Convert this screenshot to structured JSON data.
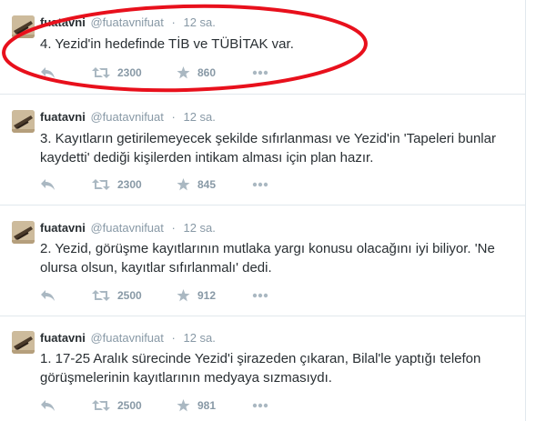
{
  "tweets": [
    {
      "name": "fuatavni",
      "handle": "@fuatavnifuat",
      "separator": "·",
      "time": "12 sa.",
      "text": "4. Yezid'in hedefinde TİB ve TÜBİTAK var.",
      "retweets": "2300",
      "favorites": "860"
    },
    {
      "name": "fuatavni",
      "handle": "@fuatavnifuat",
      "separator": "·",
      "time": "12 sa.",
      "text": "3. Kayıtların getirilemeyecek şekilde sıfırlanması ve Yezid'in 'Tapeleri bunlar kaydetti' dediği kişilerden intikam alması için plan hazır.",
      "retweets": "2300",
      "favorites": "845"
    },
    {
      "name": "fuatavni",
      "handle": "@fuatavnifuat",
      "separator": "·",
      "time": "12 sa.",
      "text": "2. Yezid, görüşme kayıtlarının mutlaka yargı konusu olacağını iyi biliyor. 'Ne olursa olsun, kayıtlar sıfırlanmalı' dedi.",
      "retweets": "2500",
      "favorites": "912"
    },
    {
      "name": "fuatavni",
      "handle": "@fuatavnifuat",
      "separator": "·",
      "time": "12 sa.",
      "text": "1. 17-25 Aralık sürecinde Yezid'i şirazeden çıkaran, Bilal'le yaptığı telefon görüşmelerinin kayıtlarının medyaya sızmasıydı.",
      "retweets": "2500",
      "favorites": "981"
    }
  ],
  "icons": {
    "reply": "reply-icon",
    "retweet": "retweet-icon",
    "favorite": "star-icon",
    "more": "more-icon"
  },
  "colors": {
    "highlight": "#e8101c",
    "icon": "#aab8c2",
    "text": "#292f33",
    "muted": "#8899a6",
    "divider": "#e1e8ed"
  }
}
